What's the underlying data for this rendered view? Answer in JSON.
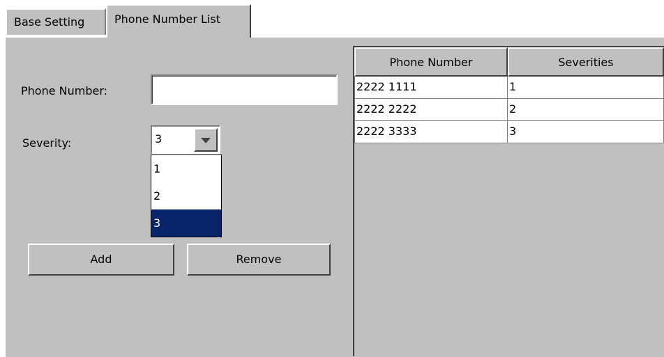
{
  "tabs": {
    "base": "Base Setting",
    "phone": "Phone Number List"
  },
  "form": {
    "phone_label": "Phone Number:",
    "phone_value": "",
    "severity_label": "Severity:",
    "severity_selected": "3",
    "severity_options": [
      "1",
      "2",
      "3"
    ],
    "add_label": "Add",
    "remove_label": "Remove"
  },
  "table": {
    "headers": [
      "Phone Number",
      "Severities"
    ],
    "rows": [
      [
        "2222 1111",
        "1"
      ],
      [
        "2222 2222",
        "2"
      ],
      [
        "2222 3333",
        "3"
      ]
    ]
  },
  "colors": {
    "panel": "#c0c0c0",
    "selection": "#0a246a"
  }
}
